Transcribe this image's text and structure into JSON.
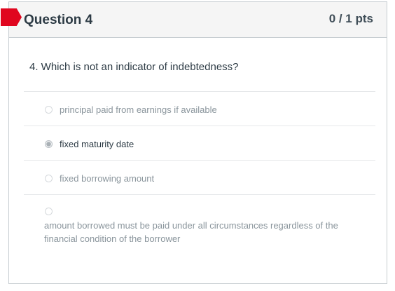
{
  "question": {
    "title": "Question 4",
    "points": "0 / 1 pts",
    "text": "4. Which is not an indicator of indebtedness?"
  },
  "answers": [
    {
      "label": "principal paid from earnings if available",
      "selected": false
    },
    {
      "label": "fixed maturity date",
      "selected": true
    },
    {
      "label": "fixed borrowing amount",
      "selected": false
    },
    {
      "label": "amount borrowed must be paid under all circumstances regardless of the financial condition of the borrower",
      "selected": false
    }
  ],
  "colors": {
    "flag": "#e0061f",
    "header_bg": "#f5f5f5",
    "border": "#c7cdd1"
  }
}
